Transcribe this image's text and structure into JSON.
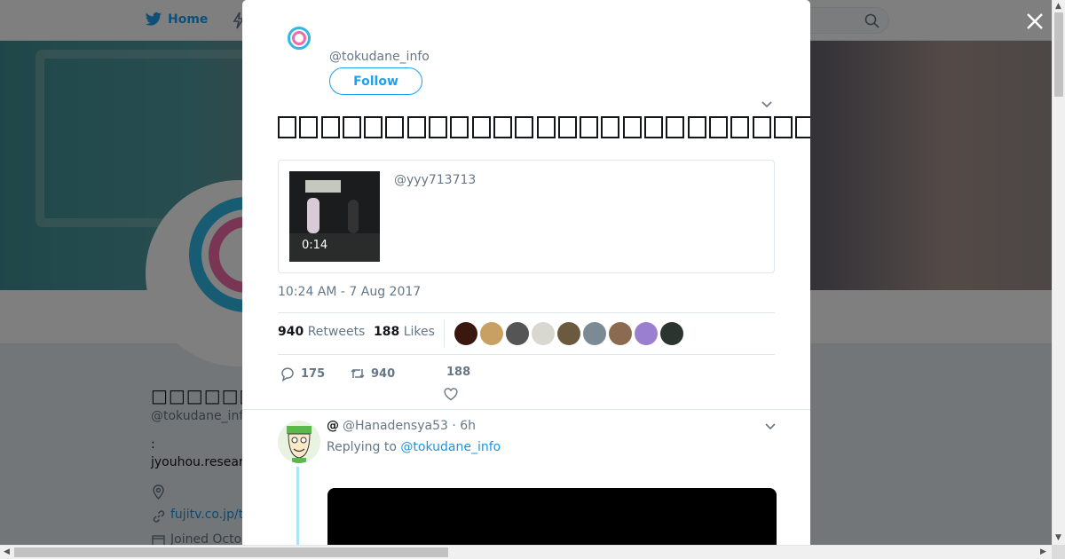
{
  "nav": {
    "home_label": "Home"
  },
  "profile": {
    "name": "□□□□□□□□□□□",
    "handle": "@tokudane_inf",
    "colon": ":",
    "bio": "jyouhou.resear",
    "url": "fujitv.co.jp/t",
    "joined": "Joined Octo"
  },
  "tweet": {
    "author_handle": "@tokudane_info",
    "follow_label": "Follow",
    "text_box_count": 38,
    "card": {
      "user": "@yyy713713",
      "duration": "0:14"
    },
    "timestamp": "10:24 AM - 7 Aug 2017",
    "stats": {
      "retweets_count": "940",
      "retweets_label": "Retweets",
      "likes_count": "188",
      "likes_label": "Likes"
    },
    "actions": {
      "reply_count": "175",
      "retweet_count": "940",
      "like_count": "188"
    },
    "liker_colors": [
      "#3a1810",
      "#c9a063",
      "#555555",
      "#d8d8d0",
      "#6b5a40",
      "#7c8a96",
      "#8a6a50",
      "#9a7fd0",
      "#2c3430"
    ]
  },
  "reply": {
    "at": "@",
    "handle_time": "@Hanadensya53 · 6h",
    "replying_prefix": "Replying to",
    "replying_to": "@tokudane_info"
  },
  "colors": {
    "accent": "#1da1f2",
    "link": "#1b95e0",
    "muted": "#657786"
  }
}
